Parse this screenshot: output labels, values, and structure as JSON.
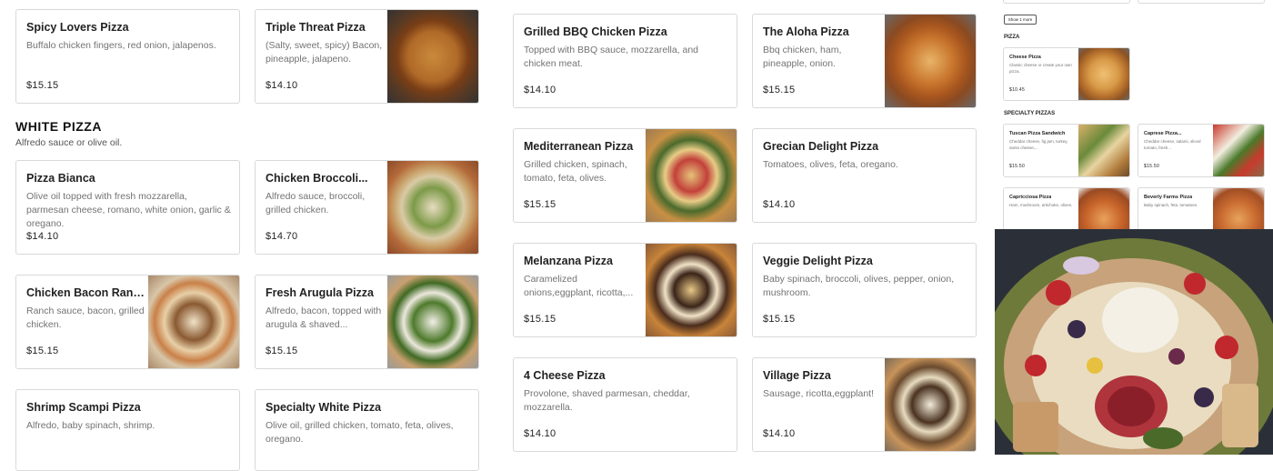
{
  "colors": {
    "accent": "#222222",
    "muted": "#737373",
    "border": "#d9d9d9"
  },
  "sections": {
    "white_pizza": {
      "title": "WHITE PIZZA",
      "subtitle": "Alfredo sauce or olive oil."
    }
  },
  "items": [
    {
      "name": "Spicy Lovers Pizza",
      "desc": "Buffalo chicken fingers, red onion, jalapenos.",
      "price": "$15.15"
    },
    {
      "name": "Triple Threat Pizza",
      "desc": "(Salty, sweet, spicy) Bacon, pineapple, jalapeno.",
      "price": "$14.10"
    },
    {
      "name": "Pizza Bianca",
      "desc": "Olive oil topped with fresh mozzarella, parmesan cheese, romano, white onion, garlic & oregano.",
      "price": "$14.10"
    },
    {
      "name": "Chicken Broccoli...",
      "desc": "Alfredo sauce, broccoli, grilled chicken.",
      "price": "$14.70"
    },
    {
      "name": "Chicken Bacon Ranch...",
      "desc": "Ranch sauce, bacon, grilled chicken.",
      "price": "$15.15"
    },
    {
      "name": "Fresh Arugula Pizza",
      "desc": "Alfredo, bacon, topped with arugula & shaved...",
      "price": "$15.15"
    },
    {
      "name": "Shrimp Scampi Pizza",
      "desc": "Alfredo, baby spinach, shrimp.",
      "price": ""
    },
    {
      "name": "Specialty White Pizza",
      "desc": "Olive oil, grilled chicken, tomato, feta, olives, oregano.",
      "price": ""
    },
    {
      "name": "Grilled BBQ Chicken Pizza",
      "desc": "Topped with BBQ sauce, mozzarella, and chicken meat.",
      "price": "$14.10"
    },
    {
      "name": "The Aloha Pizza",
      "desc": "Bbq chicken, ham, pineapple, onion.",
      "price": "$15.15"
    },
    {
      "name": "Mediterranean Pizza",
      "desc": "Grilled chicken, spinach, tomato, feta, olives.",
      "price": "$15.15"
    },
    {
      "name": "Grecian Delight Pizza",
      "desc": "Tomatoes, olives, feta, oregano.",
      "price": "$14.10"
    },
    {
      "name": "Melanzana Pizza",
      "desc": "Caramelized onions,eggplant, ricotta,...",
      "price": "$15.15"
    },
    {
      "name": "Veggie Delight Pizza",
      "desc": "Baby spinach, broccoli, olives, pepper, onion, mushroom.",
      "price": "$15.15"
    },
    {
      "name": "4 Cheese Pizza",
      "desc": "Provolone, shaved parmesan, cheddar, mozzarella.",
      "price": "$14.10"
    },
    {
      "name": "Village Pizza",
      "desc": "Sausage, ricotta,eggplant!",
      "price": "$14.10"
    }
  ],
  "mini": {
    "show_more": "Show 1 more",
    "pizza_title": "PIZZA",
    "specialty_title": "SPECIALTY PIZZAS",
    "items": [
      {
        "name": "Cheese Pizza",
        "desc": "Classic cheese or create your own pizza.",
        "price": "$10.45"
      },
      {
        "name": "Tuscan Pizza Sandwich",
        "desc": "Cheddar cheese, fig jam, turkey, swiss cheese,...",
        "price": "$15.50"
      },
      {
        "name": "Caprese Pizza...",
        "desc": "Cheddar cheese, salami, sliced tomato, fresh...",
        "price": "$15.50"
      },
      {
        "name": "Capricciosa Pizza",
        "desc": "Ham, mushroom, artichoke, olives.",
        "price": ""
      },
      {
        "name": "Beverly Farms Pizza",
        "desc": "Baby spinach, feta, tomatoes.",
        "price": ""
      }
    ]
  }
}
